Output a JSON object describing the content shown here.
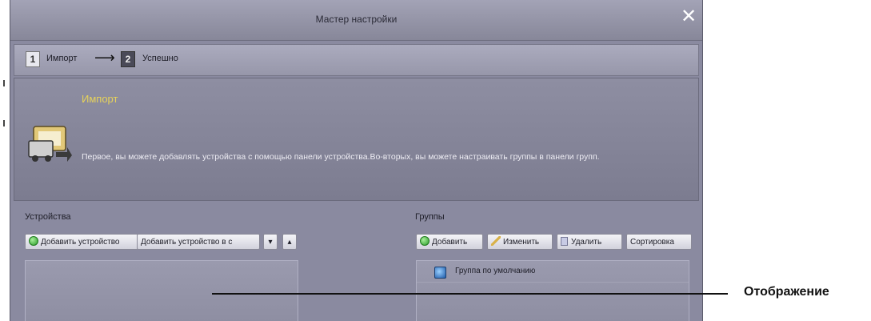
{
  "window": {
    "title": "Мастер настройки",
    "close_glyph": "✕"
  },
  "steps": {
    "step1_num": "1",
    "step1_label": "Импорт",
    "arrow": "⟶",
    "step2_num": "2",
    "step2_label": "Успешно"
  },
  "info": {
    "title": "Импорт",
    "icon": "import-wizard-icon",
    "text": "Первое, вы можете добавлять устройства с помощью панели устройства.Во-вторых, вы можете настраивать группы в панели групп."
  },
  "devices": {
    "label": "Устройства",
    "add_device_button": "Добавить устройство",
    "add_device_to_group_button": "Добавить устройство в с",
    "expand_glyph": "▾",
    "collapse_glyph": "▴"
  },
  "groups": {
    "label": "Группы",
    "add_button": "Добавить",
    "edit_button": "Изменить",
    "delete_button": "Удалить",
    "sort_button": "Сортировка",
    "items": [
      {
        "name": "Группа по умолчанию"
      }
    ]
  },
  "callout": {
    "text": "Отображение"
  },
  "colors": {
    "window_bg": "#8a8aa0",
    "title_accent": "#e6d25a",
    "close_icon": "#ffffff"
  }
}
